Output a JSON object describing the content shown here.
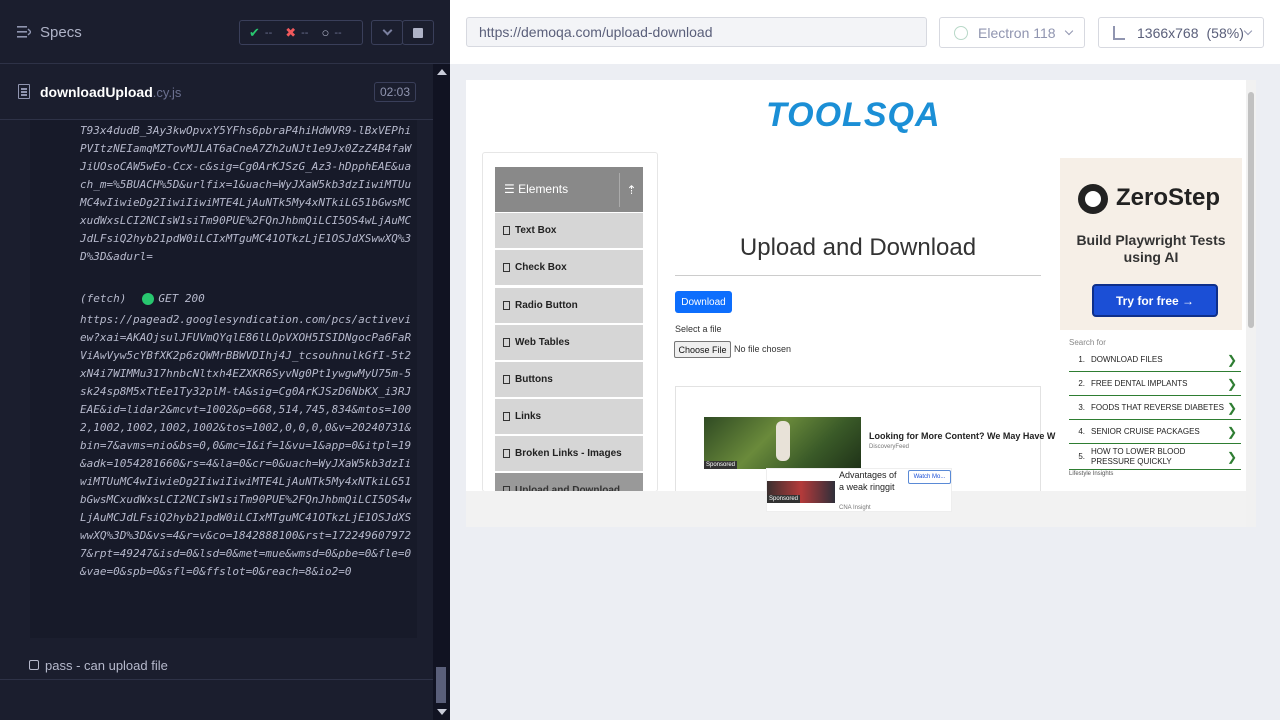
{
  "reporter": {
    "specs_title": "Specs",
    "stats": {
      "passed": "--",
      "failed": "--",
      "pending": "--"
    },
    "spec": {
      "name": "downloadUpload",
      "ext": ".cy.js",
      "duration": "02:03"
    },
    "log_top": "T93x4dudB_3Ay3kwOpvxY5YFhs6pbraP4hiHdWVR9-lBxVEPhiPVItzNEIamqMZTovMJLAT6aCneA7Zh2uNJt1e9Jx0ZzZ4B4faWJiUOsoCAW5wEo-Ccx-c&sig=Cg0ArKJSzG_Az3-hDpphEAE&uach_m=%5BUACH%5D&urlfix=1&uach=WyJXaW5kb3dzIiwiMTUuMC4wIiwieDg2IiwiIiwiMTE4LjAuNTk5My4xNTkiLG51bGwsMCxudWxsLCI2NCIsW1siTm90PUE%2FQnJhbmQiLCI5OS4wLjAuMCJdLFsiQ2hyb21pdW0iLCIxMTguMC41OTkzLjE1OSJdXSwwXQ%3D%3D&adurl=",
    "fetch": {
      "type": "(fetch)",
      "method": "GET 200"
    },
    "log_bottom": "https://pagead2.googlesyndication.com/pcs/activeview?xai=AKAOjsulJFUVmQYqlE86lLOpVXOH5ISIDNgocPa6FaRViAwVyw5cYBfXK2p6zQWMrBBWVDIhj4J_tcsouhnulkGfI-5t2xN4i7WIMMu317hnbcNltxh4EZXKR6SyvNg0Pt1ywgwMyU75m-5sk24sp8M5xTtEe1Ty32plM-tA&sig=Cg0ArKJSzD6NbKX_i3RJEAE&id=lidar2&mcvt=1002&p=668,514,745,834&mtos=1002,1002,1002,1002,1002&tos=1002,0,0,0,0&v=20240731&bin=7&avms=nio&bs=0,0&mc=1&if=1&vu=1&app=0&itpl=19&adk=1054281660&rs=4&la=0&cr=0&uach=WyJXaW5kb3dzIiwiMTUuMC4wIiwieDg2IiwiIiwiMTE4LjAuNTk5My4xNTkiLG51bGwsMCxudWxsLCI2NCIsW1siTm90PUE%2FQnJhbmQiLCI5OS4wLjAuMCJdLFsiQ2hyb21pdW0iLCIxMTguMC41OTkzLjE1OSJdXSwwXQ%3D%3D&vs=4&r=v&co=1842888100&rst=1722496079727&rpt=49247&isd=0&lsd=0&met=mue&wmsd=0&pbe=0&fle=0&vae=0&spb=0&sfl=0&ffslot=0&reach=8&io2=0",
    "test_label": "pass - can upload file"
  },
  "app_header": {
    "url": "https://demoqa.com/upload-download",
    "browser": "Electron 118",
    "viewport": "1366x768",
    "zoom": "(58%)"
  },
  "aut": {
    "logo_text": "TOOLSQA",
    "elements_header": "Elements",
    "menu_items": [
      "Text Box",
      "Check Box",
      "Radio Button",
      "Web Tables",
      "Buttons",
      "Links",
      "Broken Links - Images",
      "Upload and Download"
    ],
    "page_title": "Upload and Download",
    "download_button": "Download",
    "select_label": "Select a file",
    "choose_button": "Choose File",
    "no_file": "No file chosen",
    "ad": {
      "headline": "Looking for More Content? We May Have W",
      "source": "DiscoveryFeed",
      "sponsored": "Sponsored"
    },
    "right_ad": {
      "brand": "ZeroStep",
      "tagline": "Build Playwright Tests using AI",
      "cta": "Try for free →"
    },
    "search_ad": {
      "title": "Search for",
      "items": [
        {
          "n": "1.",
          "t": "DOWNLOAD FILES"
        },
        {
          "n": "2.",
          "t": "FREE DENTAL IMPLANTS"
        },
        {
          "n": "3.",
          "t": "FOODS THAT REVERSE DIABETES"
        },
        {
          "n": "4.",
          "t": "SENIOR CRUISE PACKAGES"
        },
        {
          "n": "5.",
          "t": "HOW TO LOWER BLOOD PRESSURE QUICKLY"
        }
      ],
      "footer": "Lifestyle Insights"
    },
    "bottom_ad": {
      "text": "Advantages of a weak ringgit",
      "watch": "Watch Mo...",
      "source": "CNA Insight",
      "sponsored": "Sponsored"
    }
  }
}
